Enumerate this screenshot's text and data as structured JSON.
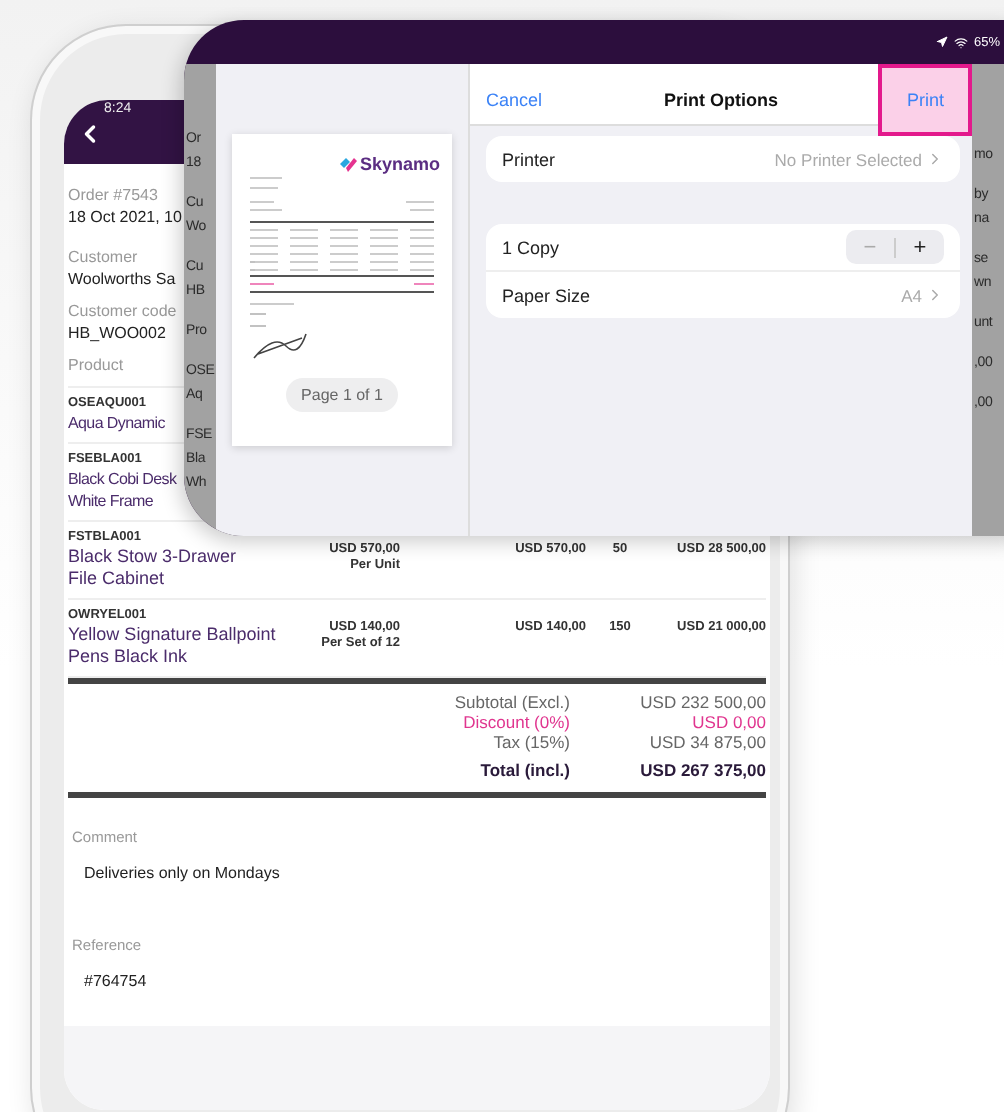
{
  "phone": {
    "status_time": "8:24",
    "order_label": "Order #7543",
    "order_date": "18 Oct 2021, 10",
    "fields": [
      {
        "label": "Customer",
        "value": "Woolworths Sa"
      },
      {
        "label": "Customer code",
        "value": "HB_WOO002"
      }
    ],
    "product_heading": "Product",
    "products": [
      {
        "code": "OSEAQU001",
        "name": "Aqua Dynamic"
      },
      {
        "code": "FSEBLA001",
        "name": "Black Cobi Desk\nWhite Frame"
      },
      {
        "code": "FSTBLA001",
        "name": "Black Stow 3-Drawer\nFile Cabinet",
        "price": "USD 570,00",
        "price_unit": "Per Unit",
        "unit_price": "USD 570,00",
        "quantity": "50",
        "total": "USD 28 500,00"
      },
      {
        "code": "OWRYEL001",
        "name": "Yellow Signature Ballpoint\nPens Black Ink",
        "price": "USD 140,00",
        "price_unit": "Per Set of 12",
        "unit_price": "USD 140,00",
        "quantity": "150",
        "total": "USD 21 000,00"
      }
    ],
    "totals": [
      {
        "kind": "normal",
        "label": "Subtotal (Excl.)",
        "value": "USD 232 500,00"
      },
      {
        "kind": "discount",
        "label": "Discount (0%)",
        "value": "USD 0,00"
      },
      {
        "kind": "normal",
        "label": "Tax (15%)",
        "value": "USD 34 875,00"
      },
      {
        "kind": "total",
        "label": "Total (incl.)",
        "value": "USD 267 375,00"
      }
    ],
    "comment": {
      "label": "Comment",
      "value": "Deliveries only on Mondays"
    },
    "reference": {
      "label": "Reference",
      "value": "#764754"
    }
  },
  "tablet": {
    "battery": "65%",
    "left_fragments": [
      [
        "Or",
        "18"
      ],
      [
        "Cu",
        "Wo"
      ],
      [
        "Cu",
        "HB"
      ],
      [
        "Pro"
      ],
      [
        "OSE",
        "Aq"
      ],
      [
        "FSE",
        "Bla",
        "Wh"
      ]
    ],
    "right_fragments": [
      [
        "mo"
      ],
      [
        "by",
        "na"
      ],
      [
        "se",
        "wn"
      ],
      [
        "unt"
      ],
      [
        ",00"
      ],
      [
        ",00"
      ]
    ],
    "print_dialog": {
      "cancel": "Cancel",
      "title": "Print Options",
      "print": {
        "label": "Print",
        "highlighted": true
      },
      "printer": {
        "label": "Printer",
        "value": "No Printer Selected"
      },
      "copies": {
        "label": "1 Copy",
        "minus": "−",
        "plus": "+"
      },
      "paper_size": {
        "label": "Paper Size",
        "value": "A4"
      },
      "preview": {
        "logo": "Skynamo",
        "page_label": "Page 1 of 1"
      }
    }
  }
}
